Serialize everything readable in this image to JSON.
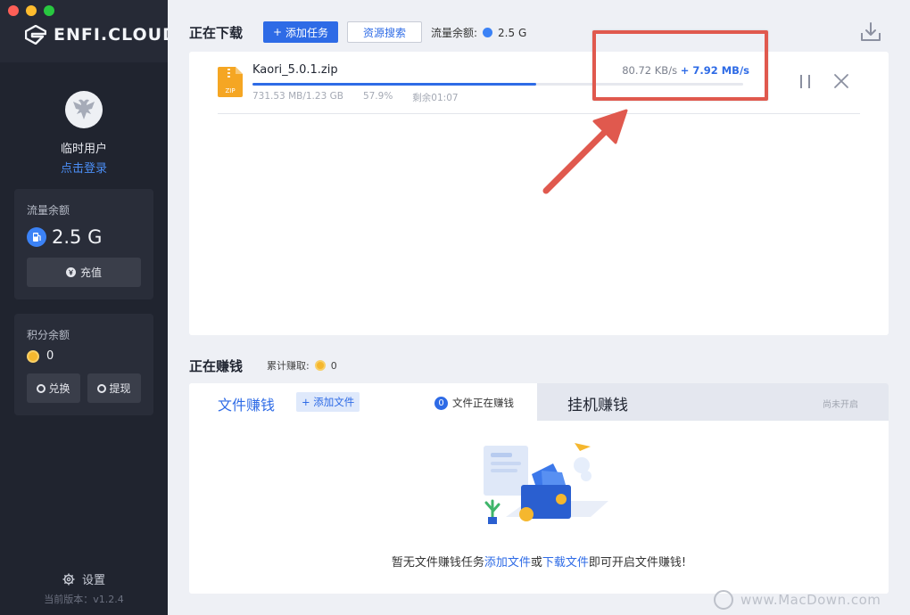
{
  "sidebar": {
    "logo_text": "ENFI.CLOUD",
    "username": "临时用户",
    "login": "点击登录",
    "traffic": {
      "label": "流量余额",
      "value": "2.5 G",
      "recharge": "充值"
    },
    "points": {
      "label": "积分余额",
      "value": "0",
      "exchange": "兑换",
      "withdraw": "提现"
    },
    "settings": "设置",
    "version": "当前版本：v1.2.4"
  },
  "header": {
    "title": "正在下载",
    "add_task": "添加任务",
    "resource_search": "资源搜索",
    "balance_label": "流量余额:",
    "balance_value": "2.5 G"
  },
  "download": {
    "filename": "Kaori_5.0.1.zip",
    "speed": "80.72 KB/s",
    "boost": "+ 7.92 MB/s",
    "size": "731.53 MB/1.23 GB",
    "percent": "57.9%",
    "remaining": "剩余01:07",
    "progress": 0.579,
    "file_badge": "ZIP"
  },
  "earning": {
    "title": "正在赚钱",
    "total_label": "累计赚取:",
    "total_value": "0",
    "tab_file": "文件赚钱",
    "add_file": "+ 添加文件",
    "file_count": "0",
    "file_count_label": "文件正在赚钱",
    "tab_idle": "挂机赚钱",
    "idle_status": "尚未开启",
    "empty_prefix": "暂无文件赚钱任务",
    "link_add": "添加文件",
    "or": "或",
    "link_download": "下载文件",
    "empty_suffix": "即可开启文件赚钱!"
  },
  "watermark": "www.MacDown.com",
  "colors": {
    "accent": "#2e6be6",
    "sidebar": "#20242f",
    "annotation": "#e0594e"
  }
}
